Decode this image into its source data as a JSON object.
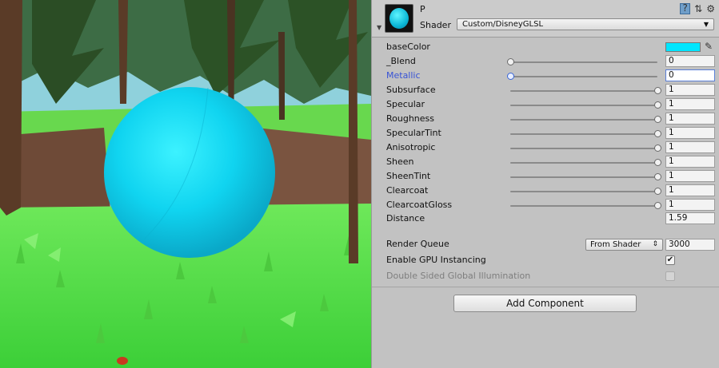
{
  "inspector": {
    "material_name": "P",
    "shader_label": "Shader",
    "shader_value": "Custom/DisneyGLSL",
    "base_color_label": "baseColor",
    "base_color_value": "#00e6ff",
    "sliders": [
      {
        "label": "_Blend",
        "value": "0",
        "level": 0
      },
      {
        "label": "Metallic",
        "value": "0",
        "level": 0
      },
      {
        "label": "Subsurface",
        "value": "1",
        "level": 1
      },
      {
        "label": "Specular",
        "value": "1",
        "level": 1
      },
      {
        "label": "Roughness",
        "value": "1",
        "level": 1
      },
      {
        "label": "SpecularTint",
        "value": "1",
        "level": 1
      },
      {
        "label": "Anisotropic",
        "value": "1",
        "level": 1
      },
      {
        "label": "Sheen",
        "value": "1",
        "level": 1
      },
      {
        "label": "SheenTint",
        "value": "1",
        "level": 1
      },
      {
        "label": "Clearcoat",
        "value": "1",
        "level": 1
      },
      {
        "label": "ClearcoatGloss",
        "value": "1",
        "level": 1
      }
    ],
    "distance_label": "Distance",
    "distance_value": "1.59",
    "render_queue_label": "Render Queue",
    "render_queue_mode": "From Shader",
    "render_queue_value": "3000",
    "gpu_instancing_label": "Enable GPU Instancing",
    "gpu_instancing_checked": true,
    "double_sided_gi_label": "Double Sided Global Illumination",
    "double_sided_gi_checked": false,
    "add_component_label": "Add Component"
  },
  "colors": {
    "sphere": "#10d4f0",
    "active_label": "#3753d6",
    "grass": "#52e04a",
    "sky": "#8fd1dc"
  }
}
